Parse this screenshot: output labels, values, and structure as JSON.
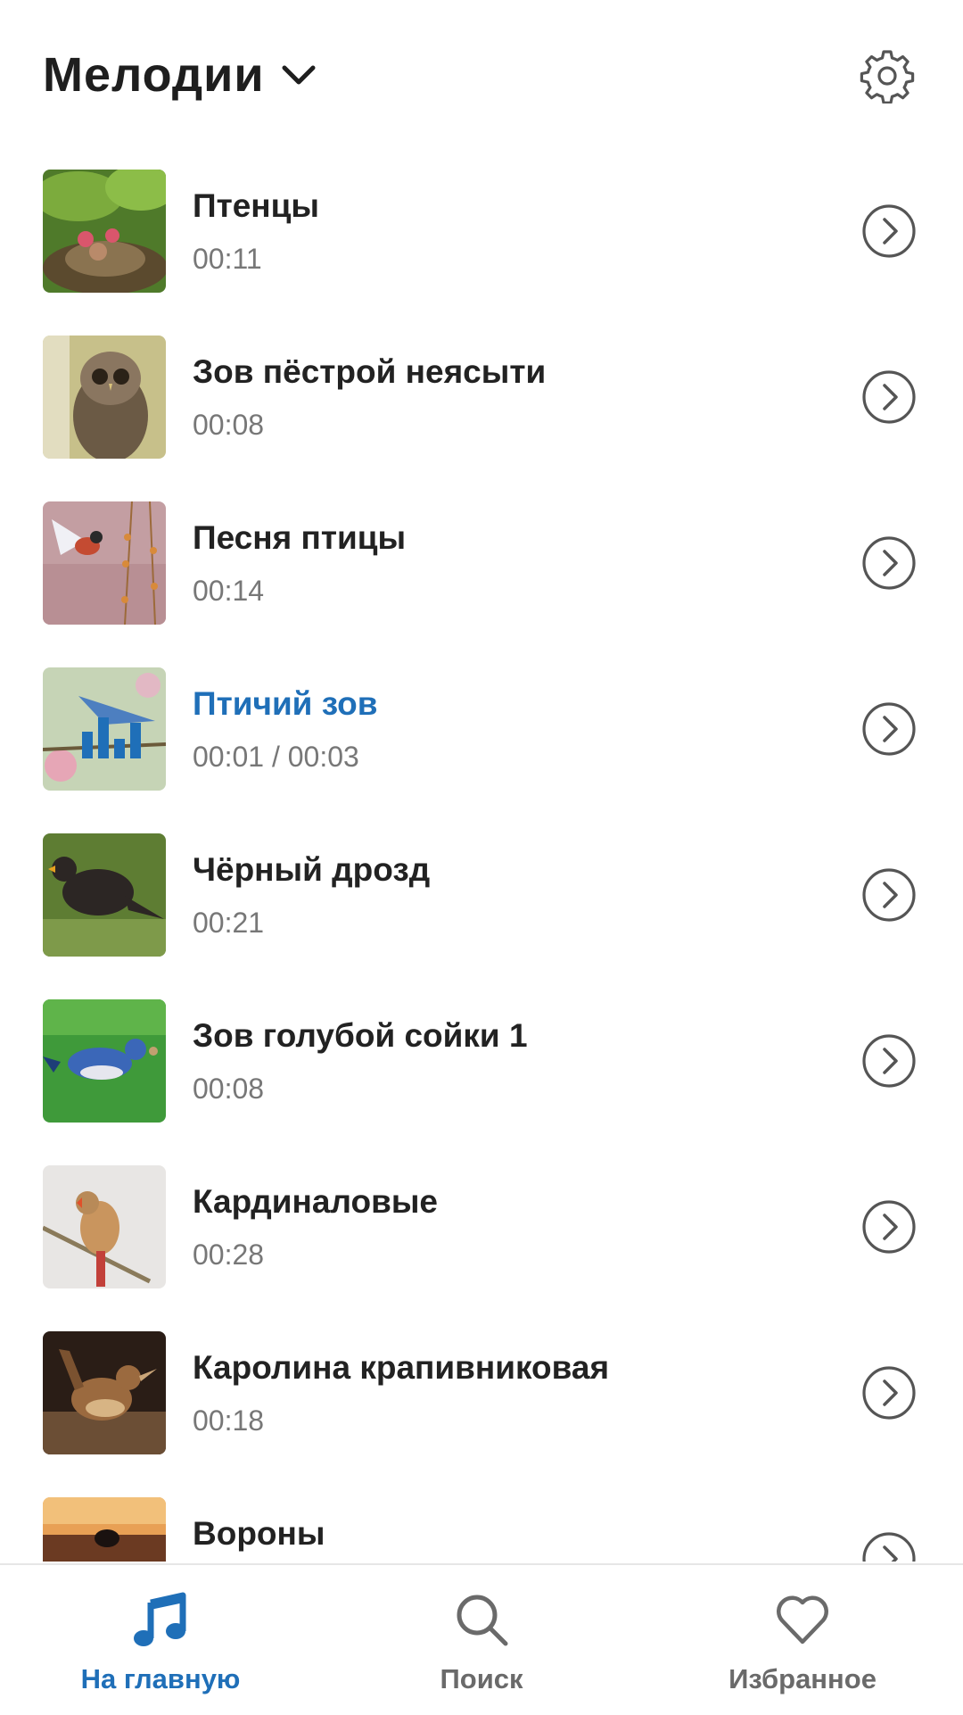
{
  "header": {
    "title": "Мелодии",
    "dropdown_icon": "chevron-down-icon",
    "settings_icon": "gear-icon"
  },
  "colors": {
    "accent": "#1f6fb8",
    "text": "#222222",
    "secondary_text": "#777777"
  },
  "list": {
    "items": [
      {
        "title": "Птенцы",
        "duration": "00:11",
        "thumb": "chicks-nest"
      },
      {
        "title": "Зов пёстрой неясыти",
        "duration": "00:08",
        "thumb": "barred-owl"
      },
      {
        "title": "Песня птицы",
        "duration": "00:14",
        "thumb": "bird-flight"
      },
      {
        "title": "Птичий зов",
        "duration": "00:01 / 00:03",
        "thumb": "blue-bird",
        "playing": true
      },
      {
        "title": "Чёрный дрозд",
        "duration": "00:21",
        "thumb": "blackbird"
      },
      {
        "title": "Зов голубой сойки 1",
        "duration": "00:08",
        "thumb": "blue-jay"
      },
      {
        "title": "Кардиналовые",
        "duration": "00:28",
        "thumb": "cardinal"
      },
      {
        "title": "Каролина крапивниковая",
        "duration": "00:18",
        "thumb": "wren"
      },
      {
        "title": "Вороны",
        "duration": "",
        "thumb": "crow"
      }
    ]
  },
  "bottom_nav": {
    "home": {
      "label": "На главную",
      "icon": "music-note-icon",
      "active": true
    },
    "search": {
      "label": "Поиск",
      "icon": "search-icon"
    },
    "favorites": {
      "label": "Избранное",
      "icon": "heart-icon"
    }
  }
}
